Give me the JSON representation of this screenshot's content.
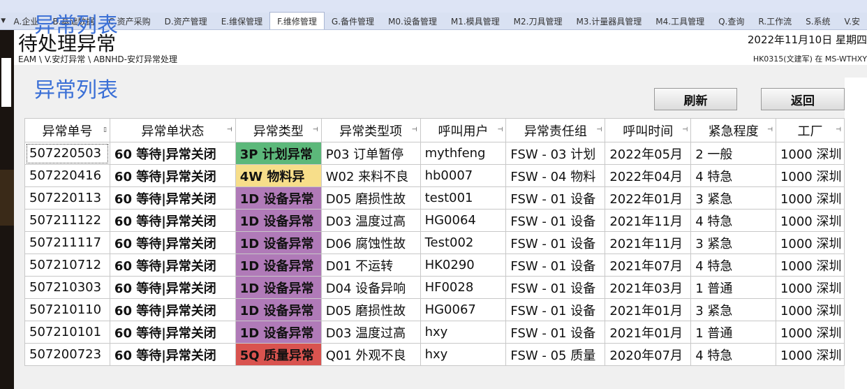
{
  "tabs": [
    "A.企业",
    "B.基础数据",
    "C.资产采购",
    "D.资产管理",
    "E.维保管理",
    "F.维修管理",
    "G.备件管理",
    "M0.设备管理",
    "M1.模具管理",
    "M2.刀具管理",
    "M3.计量器具管理",
    "M4.工具管理",
    "Q.查询",
    "R.工作流",
    "S.系统",
    "V.安"
  ],
  "active_tab": "F.维修管理",
  "header": {
    "title": "待处理异常",
    "breadcrumb": "EAM \\ V.安灯异常 \\ ABNHD-安灯异常处理",
    "datetime": "2022年11月10日 星期四",
    "user": "HK0315(文建军) 在 MS-WTHXY"
  },
  "section": {
    "title": "异常列表",
    "refresh_label": "刷新",
    "back_label": "返回"
  },
  "columns": [
    "异常单号",
    "异常单状态",
    "异常类型",
    "异常类型项",
    "呼叫用户",
    "异常责任组",
    "呼叫时间",
    "紧急程度",
    "工厂"
  ],
  "type_colors": {
    "3P 计划异常": "#5cb87a",
    "4W 物料异": "#f7de8a",
    "1D 设备异常": "#b07ab8",
    "5Q 质量异常": "#d9534f"
  },
  "rows": [
    [
      "507220503",
      "60 等待|异常关闭",
      "3P 计划异常",
      "P03 订单暂停",
      "mythfeng",
      "FSW - 03 计划",
      "2022年05月",
      "2 一般",
      "1000 深圳"
    ],
    [
      "507220416",
      "60 等待|异常关闭",
      "4W 物料异",
      "W02 来料不良",
      "hb0007",
      "FSW - 04 物料",
      "2022年04月",
      "4 特急",
      "1000 深圳"
    ],
    [
      "507220113",
      "60 等待|异常关闭",
      "1D 设备异常",
      "D05 磨损性故",
      "test001",
      "FSW - 01 设备",
      "2022年01月",
      "3 紧急",
      "1000 深圳"
    ],
    [
      "507211122",
      "60 等待|异常关闭",
      "1D 设备异常",
      "D03 温度过高",
      "HG0064",
      "FSW - 01 设备",
      "2021年11月",
      "4 特急",
      "1000 深圳"
    ],
    [
      "507211117",
      "60 等待|异常关闭",
      "1D 设备异常",
      "D06 腐蚀性故",
      "Test002",
      "FSW - 01 设备",
      "2021年11月",
      "3 紧急",
      "1000 深圳"
    ],
    [
      "507210712",
      "60 等待|异常关闭",
      "1D 设备异常",
      "D01 不运转",
      "HK0290",
      "FSW - 01 设备",
      "2021年07月",
      "4 特急",
      "1000 深圳"
    ],
    [
      "507210303",
      "60 等待|异常关闭",
      "1D 设备异常",
      "D04 设备异响",
      "HF0028",
      "FSW - 01 设备",
      "2021年03月",
      "1 普通",
      "1000 深圳"
    ],
    [
      "507210110",
      "60 等待|异常关闭",
      "1D 设备异常",
      "D05 磨损性故",
      "HG0067",
      "FSW - 01 设备",
      "2021年01月",
      "3 紧急",
      "1000 深圳"
    ],
    [
      "507210101",
      "60 等待|异常关闭",
      "1D 设备异常",
      "D03 温度过高",
      "hxy",
      "FSW - 01 设备",
      "2021年01月",
      "1 普通",
      "1000 深圳"
    ],
    [
      "507200723",
      "60 等待|异常关闭",
      "5Q 质量异常",
      "Q01 外观不良",
      "hxy",
      "FSW - 05 质量",
      "2020年07月",
      "4 特急",
      "1000 深圳"
    ]
  ]
}
